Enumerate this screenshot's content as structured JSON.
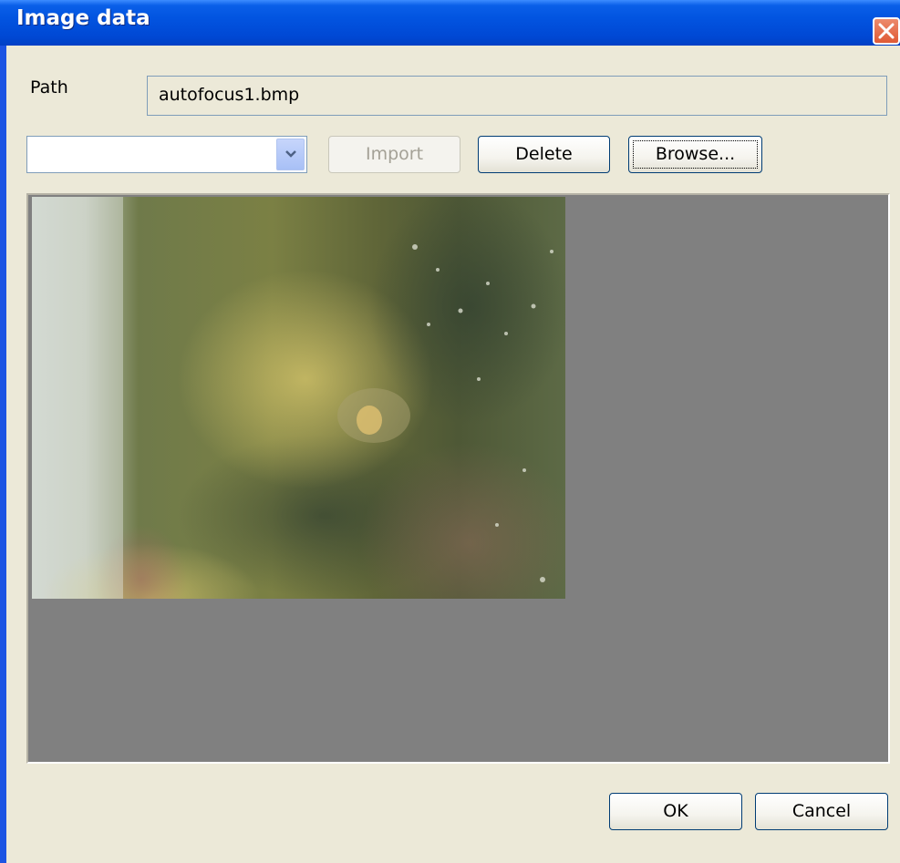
{
  "window": {
    "title": "Image data"
  },
  "path": {
    "label": "Path",
    "value": "autofocus1.bmp"
  },
  "combo": {
    "value": ""
  },
  "buttons": {
    "import": "Import",
    "delete": "Delete",
    "browse": "Browse...",
    "ok": "OK",
    "cancel": "Cancel"
  },
  "colors": {
    "titlebar": "#0254e0",
    "dialog_bg": "#ece9d8",
    "preview_bg": "#808080",
    "close": "#e05a35"
  },
  "icons": [
    "close-icon",
    "chevron-down-icon"
  ]
}
